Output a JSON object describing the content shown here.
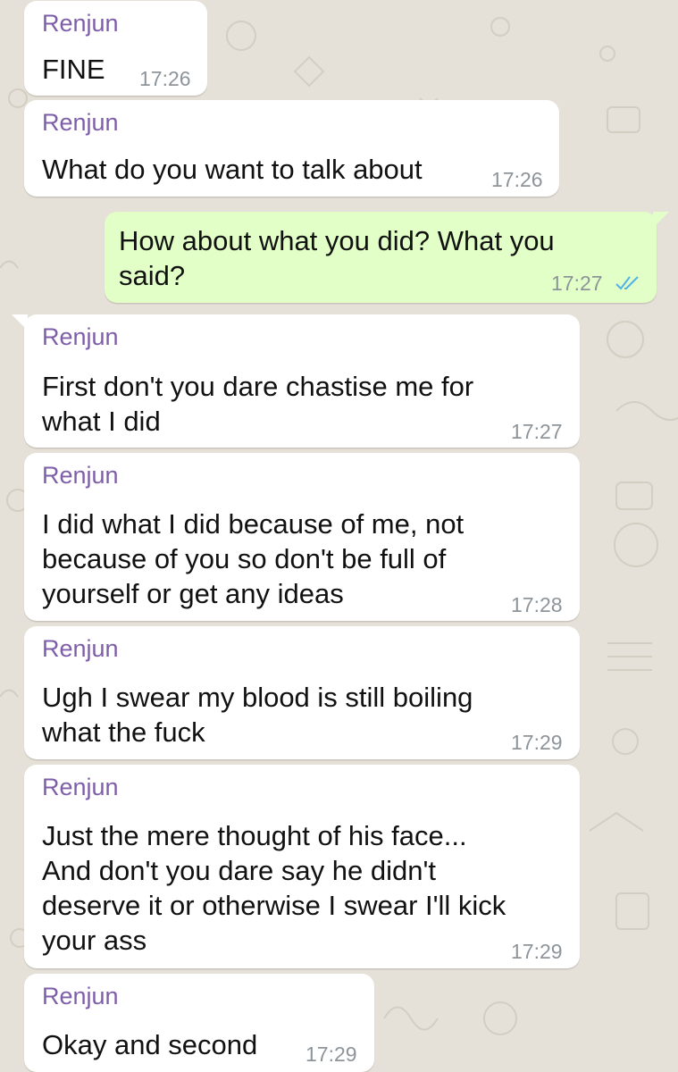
{
  "chat": {
    "colors": {
      "background": "#e6e1d8",
      "incoming_bubble": "#ffffff",
      "outgoing_bubble": "#e2ffc7",
      "sender_name": "#7e5ea8",
      "timestamp": "#8d949a",
      "read_ticks": "#4fb3e8"
    },
    "messages": [
      {
        "direction": "incoming",
        "sender": "Renjun",
        "lines": [
          "FINE"
        ],
        "time": "17:26"
      },
      {
        "direction": "incoming",
        "sender": "Renjun",
        "lines": [
          "What do you want to talk about"
        ],
        "time": "17:26"
      },
      {
        "direction": "outgoing",
        "lines": [
          "How about what you did? What you",
          "said?"
        ],
        "time": "17:27",
        "status_icon": "double-check-read-icon"
      },
      {
        "direction": "incoming",
        "sender": "Renjun",
        "lines": [
          "First don't you dare chastise me for",
          "what I did"
        ],
        "time": "17:27"
      },
      {
        "direction": "incoming",
        "sender": "Renjun",
        "lines": [
          "I did what I did because of me, not",
          "because of you so don't be full of",
          "yourself or get any ideas"
        ],
        "time": "17:28"
      },
      {
        "direction": "incoming",
        "sender": "Renjun",
        "lines": [
          "Ugh I swear my blood is still boiling",
          "what the fuck"
        ],
        "time": "17:29"
      },
      {
        "direction": "incoming",
        "sender": "Renjun",
        "lines": [
          "Just the mere thought of his face...",
          "And don't you dare say he didn't",
          "deserve it or otherwise I swear I'll kick",
          "your ass"
        ],
        "time": "17:29"
      },
      {
        "direction": "incoming",
        "sender": "Renjun",
        "lines": [
          "Okay and second"
        ],
        "time": "17:29"
      }
    ]
  }
}
